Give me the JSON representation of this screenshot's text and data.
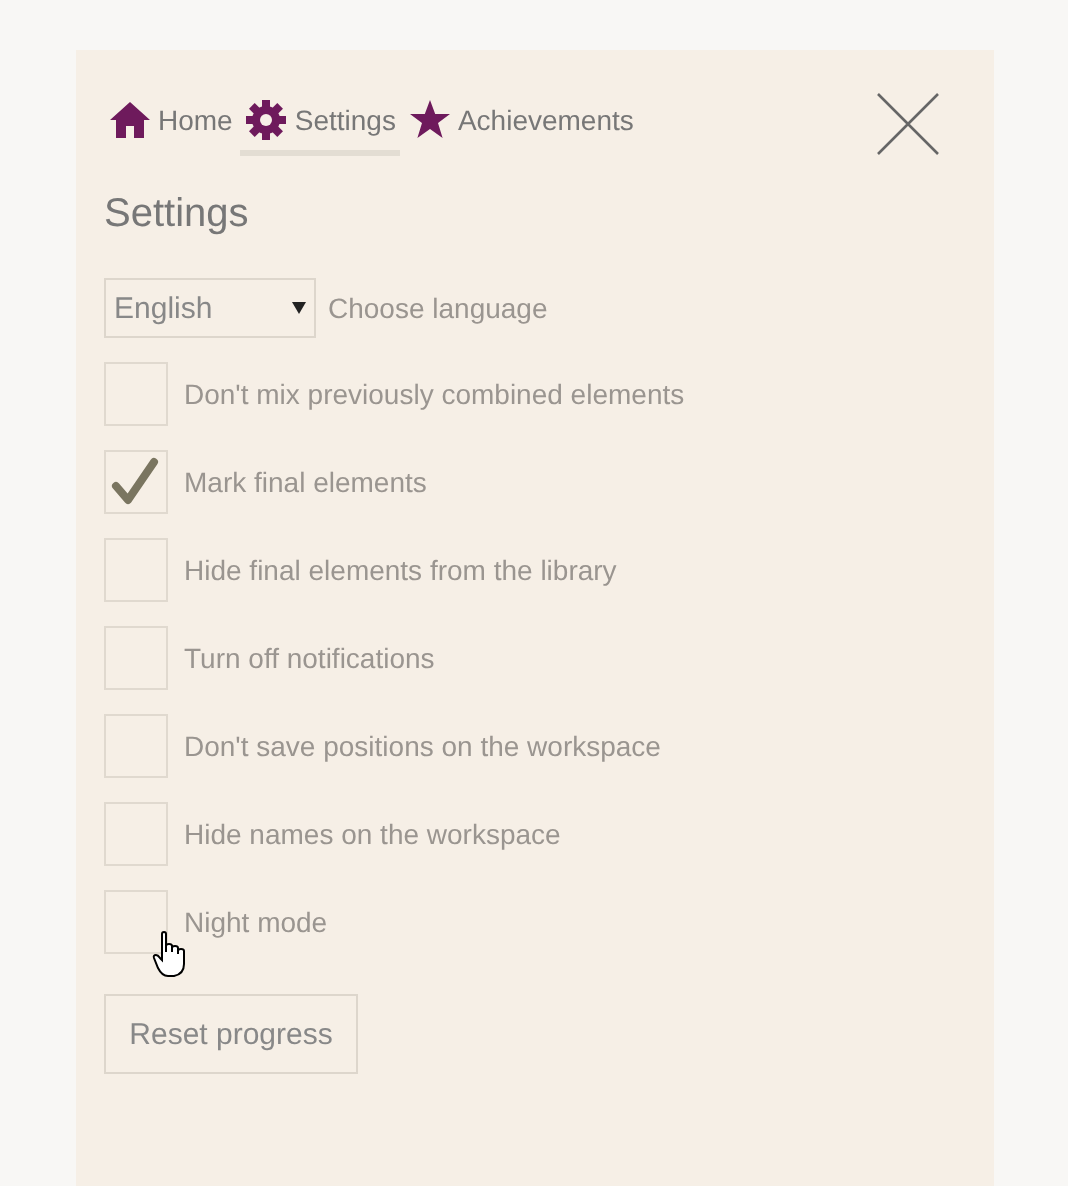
{
  "tabs": [
    {
      "label": "Home",
      "kind": "home",
      "selected": false
    },
    {
      "label": "Settings",
      "kind": "gear",
      "selected": true
    },
    {
      "label": "Achievements",
      "kind": "star",
      "selected": false
    }
  ],
  "title": "Settings",
  "language": {
    "value": "English",
    "label": "Choose language"
  },
  "options": [
    {
      "label": "Don't mix previously combined elements",
      "checked": false
    },
    {
      "label": "Mark final elements",
      "checked": true
    },
    {
      "label": "Hide final elements from the library",
      "checked": false
    },
    {
      "label": "Turn off notifications",
      "checked": false
    },
    {
      "label": "Don't save positions on the workspace",
      "checked": false
    },
    {
      "label": "Hide names on the workspace",
      "checked": false
    },
    {
      "label": "Night mode",
      "checked": false
    }
  ],
  "reset_button": "Reset progress"
}
